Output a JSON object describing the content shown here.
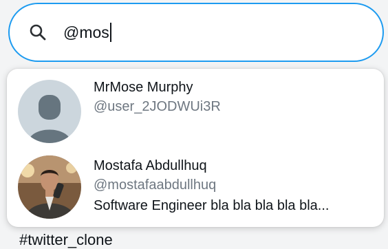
{
  "search": {
    "value": "@mos",
    "icon": "search-icon",
    "accent_color": "#1d9bf0"
  },
  "results": [
    {
      "name": "MrMose Murphy",
      "handle": "@user_2JODWUi3R",
      "avatar": "default-avatar-icon"
    },
    {
      "name": "Mostafa Abdullhuq",
      "handle": "@mostafaabdullhuq",
      "bio": "Software Engineer bla bla bla bla bla...",
      "avatar": "profile-photo"
    }
  ],
  "trend": {
    "label": "#twitter_clone"
  }
}
